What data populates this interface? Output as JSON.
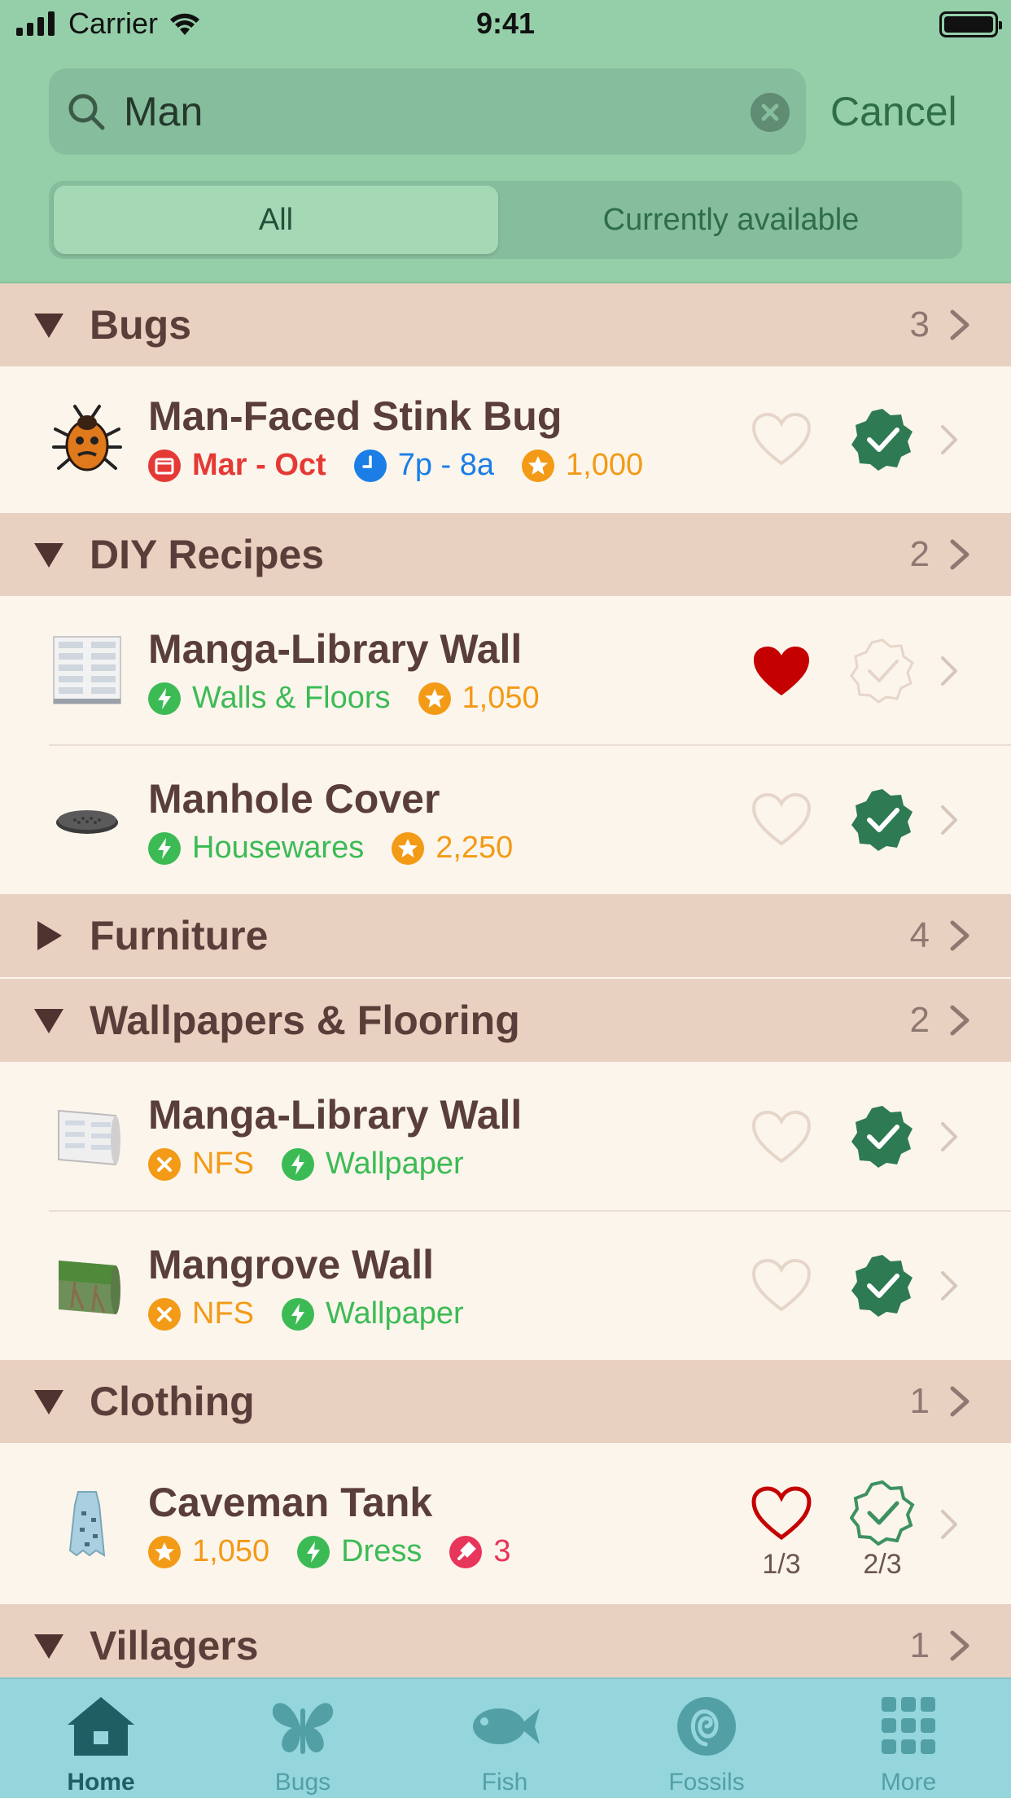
{
  "status_bar": {
    "carrier": "Carrier",
    "time": "9:41"
  },
  "search": {
    "query": "Man",
    "cancel_label": "Cancel"
  },
  "segments": {
    "all": "All",
    "current": "Currently available"
  },
  "sections": {
    "bugs": {
      "title": "Bugs",
      "count": "3"
    },
    "diy": {
      "title": "DIY Recipes",
      "count": "2"
    },
    "furniture": {
      "title": "Furniture",
      "count": "4"
    },
    "wallpapers": {
      "title": "Wallpapers & Flooring",
      "count": "2"
    },
    "clothing": {
      "title": "Clothing",
      "count": "1"
    },
    "villagers": {
      "title": "Villagers",
      "count": "1"
    }
  },
  "items": {
    "stink_bug": {
      "title": "Man-Faced Stink Bug",
      "months": "Mar - Oct",
      "time": "7p - 8a",
      "price": "1,000"
    },
    "manga_diy": {
      "title": "Manga-Library Wall",
      "category": "Walls & Floors",
      "price": "1,050"
    },
    "manhole": {
      "title": "Manhole Cover",
      "category": "Housewares",
      "price": "2,250"
    },
    "manga_wall": {
      "title": "Manga-Library Wall",
      "nfs": "NFS",
      "category": "Wallpaper"
    },
    "mangrove": {
      "title": "Mangrove Wall",
      "nfs": "NFS",
      "category": "Wallpaper"
    },
    "caveman": {
      "title": "Caveman Tank",
      "price": "1,050",
      "category": "Dress",
      "variants": "3",
      "heart_frac": "1/3",
      "check_frac": "2/3"
    }
  },
  "tabs": {
    "home": "Home",
    "bugs": "Bugs",
    "fish": "Fish",
    "fossils": "Fossils",
    "more": "More"
  },
  "colors": {
    "header": "#94cfaa",
    "section": "#e9d1c1",
    "row": "#fcf5ec",
    "tabbar": "#94d6dc",
    "donated": "#2e7a52",
    "favorite": "#c40000",
    "price": "#f39a16",
    "category": "#3cbb55",
    "time": "#1a7ee6",
    "months": "#e53935"
  }
}
